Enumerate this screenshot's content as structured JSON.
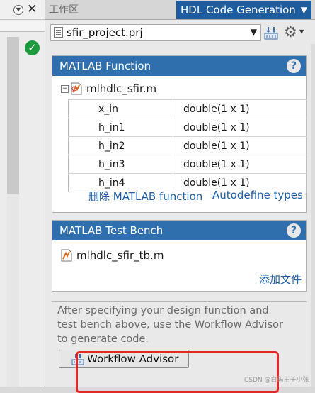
{
  "left_panel": {
    "dropdown_icon": "chevron-down-circle",
    "close_icon": "close-x",
    "status_icon": "green-checkmark",
    "status_color": "#1d9a3e"
  },
  "tabs": [
    {
      "label": "工作区",
      "active": false
    },
    {
      "label": "HDL Code Generation",
      "active": true
    }
  ],
  "toolbar": {
    "project_file": "sfir_project.prj",
    "build_icon": "build-icon",
    "settings_icon": "gear-icon"
  },
  "matlab_function": {
    "header": "MATLAB Function",
    "file": "mlhdlc_sfir.m",
    "inputs": [
      {
        "name": "x_in",
        "type": "double(1 x 1)"
      },
      {
        "name": "h_in1",
        "type": "double(1 x 1)"
      },
      {
        "name": "h_in2",
        "type": "double(1 x 1)"
      },
      {
        "name": "h_in3",
        "type": "double(1 x 1)"
      },
      {
        "name": "h_in4",
        "type": "double(1 x 1)"
      }
    ],
    "delete_link": "删除 MATLAB function",
    "autodefine_link": "Autodefine types"
  },
  "test_bench": {
    "header": "MATLAB Test Bench",
    "file": "mlhdlc_sfir_tb.m",
    "add_file_link": "添加文件"
  },
  "hint_text": "After specifying your design function and test bench above, use the Workflow Advisor to generate code.",
  "workflow_button": "Workflow Advisor",
  "watermark": "CSDN @白码王子小张",
  "colors": {
    "header_blue": "#2f6fad",
    "active_tab": "#1e5d9d",
    "link": "#1c5fa8",
    "highlight": "#e02a2a"
  }
}
